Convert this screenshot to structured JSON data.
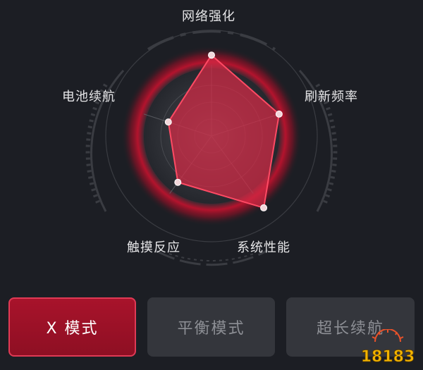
{
  "radar": {
    "axes": [
      {
        "label": "网络强化",
        "value": 0.82
      },
      {
        "label": "刷新频率",
        "value": 0.72
      },
      {
        "label": "系统性能",
        "value": 0.9
      },
      {
        "label": "触摸反应",
        "value": 0.58
      },
      {
        "label": "电池续航",
        "value": 0.46
      }
    ],
    "fill_color": "#d42a45",
    "stroke_color": "#ff4a64",
    "ring_glow_color": "#c4122e"
  },
  "modes": [
    {
      "label": "X 模式",
      "state": "active"
    },
    {
      "label": "平衡模式",
      "state": "inactive"
    },
    {
      "label": "超长续航",
      "state": "inactive"
    }
  ],
  "watermark": {
    "text": "18183",
    "colors": {
      "primary": "#f2b400",
      "secondary": "#e8522a"
    }
  }
}
